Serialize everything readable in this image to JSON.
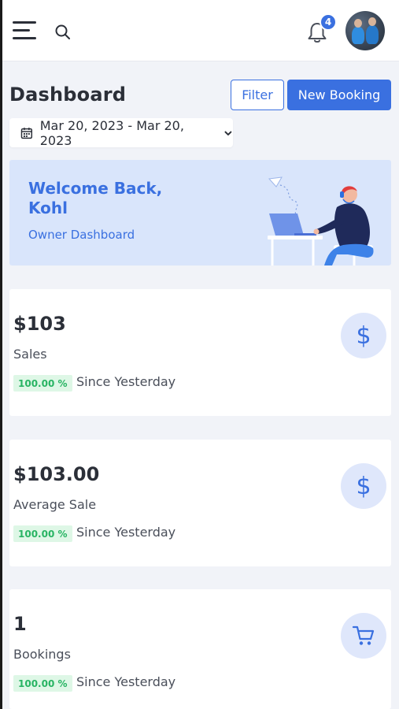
{
  "header": {
    "notification_count": "4"
  },
  "page": {
    "title": "Dashboard",
    "filter_label": "Filter",
    "new_booking_label": "New Booking",
    "date_range": "Mar 20, 2023 - Mar 20, 2023"
  },
  "welcome": {
    "title": "Welcome Back, Kohl",
    "subtitle": "Owner Dashboard"
  },
  "stats": [
    {
      "value": "$103",
      "label": "Sales",
      "change": "100.00 %",
      "since": "Since Yesterday",
      "icon": "dollar-icon",
      "icon_glyph": "$"
    },
    {
      "value": "$103.00",
      "label": "Average Sale",
      "change": "100.00 %",
      "since": "Since Yesterday",
      "icon": "dollar-icon",
      "icon_glyph": "$"
    },
    {
      "value": "1",
      "label": "Bookings",
      "change": "100.00 %",
      "since": "Since Yesterday",
      "icon": "cart-icon"
    }
  ],
  "colors": {
    "accent": "#3a70e0",
    "positive": "#28b463",
    "banner_bg": "#d9e5fb"
  }
}
